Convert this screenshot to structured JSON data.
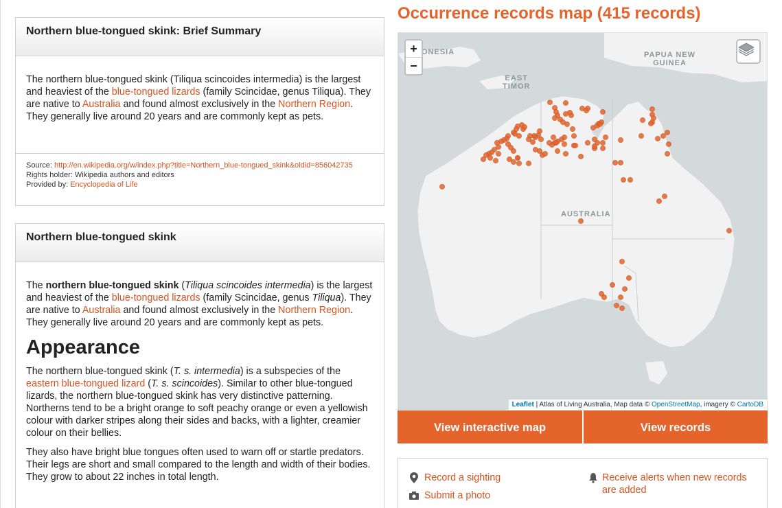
{
  "summary": {
    "title": "Northern blue-tongued skink: Brief Summary",
    "text_1": "The northern blue-tongued skink (Tiliqua scincoides intermedia) is the largest and heaviest of the ",
    "link_1": "blue-tongued lizards",
    "text_2": " (family Scincidae, genus Tiliqua). They are native to ",
    "link_2": "Australia",
    "text_3": " and found almost exclusively in the ",
    "link_3": "Northern Region",
    "text_4": ". They generally live around 20 years and are commonly kept as pets.",
    "source_label": "Source: ",
    "source_url": "http://en.wikipedia.org/w/index.php?title=Northern_blue-tongued_skink&oldid=856042735",
    "rights": "Rights holder: Wikipedia authors and editors",
    "provided_label": "Provided by: ",
    "provided_link": "Encyclopedia of Life"
  },
  "article": {
    "title": "Northern blue-tongued skink",
    "p1_a": "The ",
    "p1_bold": "northern blue-tongued skink",
    "p1_b": " (",
    "p1_italic": "Tiliqua scincoides intermedia",
    "p1_c": ") is the largest and heaviest of the ",
    "p1_link1": "blue-tongued lizards",
    "p1_d": " (family Scincidae, genus ",
    "p1_italic2": "Tiliqua",
    "p1_e": "). They are native to ",
    "p1_link2": "Australia",
    "p1_f": " and found almost exclusively in the ",
    "p1_link3": "Northern Region",
    "p1_g": ". They generally live around 20 years and are commonly kept as pets.",
    "heading": "Appearance",
    "p2_a": "The northern blue-tongued skink (",
    "p2_italic": "T. s. intermedia",
    "p2_b": ") is a subspecies of the ",
    "p2_link": "eastern blue-tongued lizard",
    "p2_c": " (",
    "p2_italic2": "T. s. scincoides",
    "p2_d": "). Similar to other blue-tongued lizards, the northern blue-tongued skink has very distinctive patterning. Northerns tend to be a bright orange to soft peachy orange or even a yellowish colour with darker stripes along their sides and backs, with a lighter, creamier colour on their bellies.",
    "p3": "They also have bright blue tongues often used to warn off or startle predators. Their legs are short and small compared to the length and width of their bodies. They grow to about 22 inches in total length."
  },
  "map": {
    "title": "Occurrence records map (415 records)",
    "zoom_in": "+",
    "zoom_out": "−",
    "labels": {
      "indonesia": "ONESIA",
      "east_timor": "EAST\nTIMOR",
      "png": "PAPUA NEW\nGUINEA",
      "australia": "AUSTRALIA"
    },
    "attribution": {
      "leaflet": "Leaflet",
      "middle": " | Atlas of Living Australia, Map data © ",
      "osm": "OpenStreetMap",
      "imagery": ", imagery © ",
      "carto": "CartoDB"
    },
    "icons": {
      "layers": "layers-icon"
    },
    "accent": "#e4642c"
  },
  "buttons": {
    "interactive_map": "View interactive map",
    "records": "View records"
  },
  "actions": {
    "sighting": "Record a sighting",
    "photo": "Submit a photo",
    "alerts": "Receive alerts when new records are added"
  }
}
